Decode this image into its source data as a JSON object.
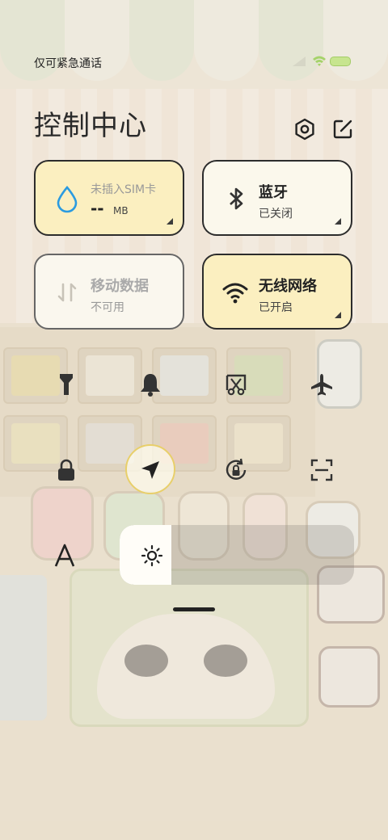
{
  "status_bar": {
    "carrier": "仅可紧急通话",
    "accent_color": "#a5d36a"
  },
  "header": {
    "title": "控制中心",
    "icons": [
      "settings-icon",
      "edit-icon"
    ]
  },
  "tiles": {
    "sim": {
      "label": "未插入SIM卡",
      "value": "--",
      "unit": "MB",
      "bg": "#fbefc0",
      "icon": "water-drop-icon"
    },
    "bluetooth": {
      "label": "蓝牙",
      "status": "已关闭",
      "bg": "#fbf8ec",
      "icon": "bluetooth-icon"
    },
    "mobile_data": {
      "label": "移动数据",
      "status": "不可用",
      "bg": "#faf7ee",
      "icon": "data-arrows-icon"
    },
    "wifi": {
      "label": "无线网络",
      "status": "已开启",
      "bg": "#fbefc0",
      "icon": "wifi-icon"
    }
  },
  "toggles": [
    {
      "name": "flashlight",
      "icon": "flashlight-icon"
    },
    {
      "name": "silent",
      "icon": "bell-icon"
    },
    {
      "name": "screenshot",
      "icon": "screenshot-icon"
    },
    {
      "name": "airplane",
      "icon": "airplane-icon"
    },
    {
      "name": "lock-screen",
      "icon": "lock-icon"
    },
    {
      "name": "location",
      "icon": "location-icon",
      "active": true,
      "active_color": "#e8cf6a"
    },
    {
      "name": "rotation-lock",
      "icon": "rotation-lock-icon"
    },
    {
      "name": "scanner",
      "icon": "scan-icon"
    },
    {
      "name": "font-size",
      "icon": "font-icon"
    }
  ],
  "brightness": {
    "level": 0.22,
    "icon": "sun-icon"
  }
}
